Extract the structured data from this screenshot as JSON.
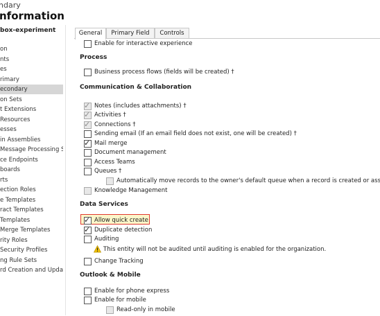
{
  "header": {
    "subtitle": "ndary",
    "title": "nformation"
  },
  "sidebar": {
    "heading": "box-experiment",
    "items": [
      {
        "label": "on"
      },
      {
        "label": "nts"
      },
      {
        "label": "es"
      },
      {
        "label": "rimary"
      },
      {
        "label": "econdary",
        "selected": true
      },
      {
        "label": "on Sets"
      },
      {
        "label": "t Extensions"
      },
      {
        "label": " Resources"
      },
      {
        "label": "esses"
      },
      {
        "label": "in Assemblies"
      },
      {
        "label": "Message Processing S..."
      },
      {
        "label": "ce Endpoints"
      },
      {
        "label": "boards"
      },
      {
        "label": "rts"
      },
      {
        "label": "ection Roles"
      },
      {
        "label": "e Templates"
      },
      {
        "label": "ract Templates"
      },
      {
        "label": " Templates"
      },
      {
        "label": "Merge Templates"
      },
      {
        "label": "rity Roles"
      },
      {
        "label": " Security Profiles"
      },
      {
        "label": "ng Rule Sets"
      },
      {
        "label": "rd Creation and Upda..."
      }
    ]
  },
  "tabs": [
    {
      "label": "General",
      "active": true
    },
    {
      "label": "Primary Field"
    },
    {
      "label": "Controls"
    }
  ],
  "form": {
    "top_row": {
      "label": "Enable for interactive experience",
      "checked": false
    },
    "process": {
      "heading": "Process",
      "items": [
        {
          "label": "Business process flows (fields will be created) †",
          "checked": false
        }
      ]
    },
    "communication": {
      "heading": "Communication & Collaboration",
      "items": [
        {
          "label": "Notes (includes attachments) †",
          "checked": true,
          "disabled": true
        },
        {
          "label": "Activities †",
          "checked": true,
          "disabled": true
        },
        {
          "label": "Connections †",
          "checked": true,
          "disabled": true
        },
        {
          "label": "Sending email (If an email field does not exist, one will be created) †",
          "checked": false
        },
        {
          "label": "Mail merge",
          "checked": true
        },
        {
          "label": "Document management",
          "checked": false
        },
        {
          "label": "Access Teams",
          "checked": false
        },
        {
          "label": "Queues †",
          "checked": false
        },
        {
          "label": "Automatically move records to the owner's default queue when a record is created or assigned.",
          "checked": false,
          "disabled": true
        },
        {
          "label": "Knowledge Management",
          "checked": false,
          "disabled": true
        }
      ]
    },
    "data_services": {
      "heading": "Data Services",
      "items": [
        {
          "label": "Allow quick create",
          "checked": true
        },
        {
          "label": "Duplicate detection",
          "checked": true
        },
        {
          "label": "Auditing",
          "checked": false
        },
        {
          "label": "Change Tracking",
          "checked": false
        }
      ],
      "audit_warning": "This entity will not be audited until auditing is enabled for the organization."
    },
    "outlook": {
      "heading": "Outlook & Mobile",
      "items": [
        {
          "label": "Enable for phone express",
          "checked": false
        },
        {
          "label": "Enable for mobile",
          "checked": false
        },
        {
          "label": "Read-only in mobile",
          "checked": false,
          "disabled": true
        }
      ]
    }
  },
  "colors": {
    "highlight_border": "#e0392f",
    "highlight_fill": "#fbf6c9",
    "selected_nav": "#d6d6d6",
    "warning": "#f2c200"
  }
}
